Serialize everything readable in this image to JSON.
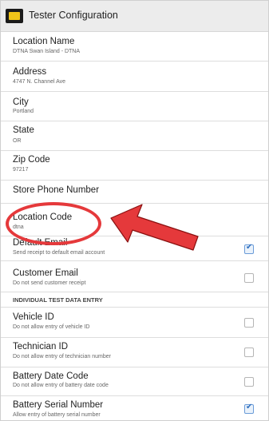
{
  "app": {
    "title": "Tester Configuration",
    "logo_icon": "battery-brand-logo"
  },
  "location": {
    "name_label": "Location Name",
    "name_value": "DTNA Swan Island - DTNA",
    "address_label": "Address",
    "address_value": "4747 N. Channel Ave",
    "city_label": "City",
    "city_value": "Portland",
    "state_label": "State",
    "state_value": "OR",
    "zip_label": "Zip Code",
    "zip_value": "97217",
    "phone_label": "Store Phone Number",
    "phone_value": "",
    "code_label": "Location Code",
    "code_value": "dtna"
  },
  "email": {
    "default_label": "Default Email",
    "default_desc": "Send receipt to default email account",
    "default_checked": true,
    "customer_label": "Customer Email",
    "customer_desc": "Do not send customer receipt",
    "customer_checked": false
  },
  "section": {
    "header": "INDIVIDUAL TEST DATA ENTRY"
  },
  "entry": {
    "vehicle_label": "Vehicle ID",
    "vehicle_desc": "Do not allow entry of vehicle ID",
    "vehicle_checked": false,
    "tech_label": "Technician ID",
    "tech_desc": "Do not allow entry of technician number",
    "tech_checked": false,
    "date_label": "Battery Date Code",
    "date_desc": "Do not allow entry of battery date code",
    "date_checked": false,
    "serial_label": "Battery Serial Number",
    "serial_desc": "Allow entry of battery serial number",
    "serial_checked": true
  },
  "annotation": {
    "color": "#e5393b"
  }
}
